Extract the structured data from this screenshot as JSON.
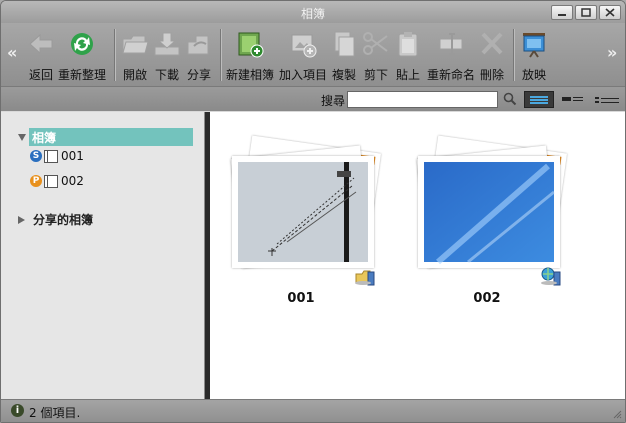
{
  "window": {
    "title": "相簿",
    "buttons": [
      "minimize",
      "maximize",
      "close"
    ]
  },
  "toolbar": {
    "items": [
      {
        "label": "返回",
        "icon": "back-arrow-icon",
        "enabled": false
      },
      {
        "label": "重新整理",
        "icon": "refresh-icon",
        "enabled": true
      },
      {
        "label": "開啟",
        "icon": "open-folder-icon",
        "enabled": false
      },
      {
        "label": "下載",
        "icon": "download-icon",
        "enabled": false
      },
      {
        "label": "分享",
        "icon": "share-icon",
        "enabled": false
      },
      {
        "label": "新建相簿",
        "icon": "new-album-icon",
        "enabled": true
      },
      {
        "label": "加入項目",
        "icon": "add-item-icon",
        "enabled": false
      },
      {
        "label": "複製",
        "icon": "copy-icon",
        "enabled": false
      },
      {
        "label": "剪下",
        "icon": "cut-icon",
        "enabled": false
      },
      {
        "label": "貼上",
        "icon": "paste-icon",
        "enabled": false
      },
      {
        "label": "重新命名",
        "icon": "rename-icon",
        "enabled": false
      },
      {
        "label": "刪除",
        "icon": "delete-icon",
        "enabled": false
      },
      {
        "label": "放映",
        "icon": "slideshow-icon",
        "enabled": true
      }
    ]
  },
  "search": {
    "label": "搜尋",
    "value": "",
    "placeholder": ""
  },
  "sidebar": {
    "root_label": "相簿",
    "albums": [
      {
        "name": "001",
        "badge": "S",
        "badge_color": "#2a6fbf"
      },
      {
        "name": "002",
        "badge": "P",
        "badge_color": "#e8901c"
      }
    ],
    "shared_label": "分享的相簿"
  },
  "main": {
    "albums": [
      {
        "name": "001",
        "share_icon": "shared-folder-icon"
      },
      {
        "name": "002",
        "share_icon": "public-web-icon"
      }
    ]
  },
  "status": {
    "text": "2 個項目."
  },
  "colors": {
    "accent": "#73c3bd",
    "toolbar_bg": "#9a9a9a",
    "splitter": "#2b2b2b"
  }
}
